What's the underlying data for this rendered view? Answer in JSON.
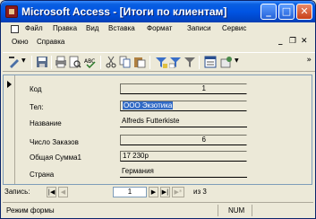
{
  "window": {
    "title": "Microsoft Access - [Итоги по клиентам]",
    "buttons": {
      "minimize": "_",
      "maximize": "□",
      "close": "✕"
    }
  },
  "menubar": {
    "items": [
      "Файл",
      "Правка",
      "Вид",
      "Вставка",
      "Формат",
      "Записи",
      "Сервис",
      "Окно",
      "Справка"
    ],
    "mdi": {
      "minimize": "_",
      "restore": "❐",
      "close": "✕"
    }
  },
  "toolbar": {
    "icons": [
      "design-view",
      "save",
      "print",
      "print-preview",
      "spelling",
      "cut",
      "copy",
      "paste",
      "filter-by-selection",
      "filter-by-form",
      "apply-filter",
      "properties",
      "new-object"
    ],
    "overflow": "»"
  },
  "form": {
    "fields": [
      {
        "label": "Код",
        "value": "1"
      },
      {
        "label": "Тел:",
        "value": "ООО Экзотика"
      },
      {
        "label": "Название",
        "value": "Alfreds Futterkiste"
      },
      {
        "label": "Число Заказов",
        "value": "6"
      },
      {
        "label": "Общая Сумма1",
        "value": "17 230р"
      },
      {
        "label": "Страна",
        "value": "Германия"
      }
    ]
  },
  "navigation": {
    "label": "Запись:",
    "current": "1",
    "total_label": "из 3",
    "buttons": {
      "first": "|◀",
      "prev": "◀",
      "next": "▶",
      "last": "▶|",
      "new": "▶*"
    }
  },
  "status": {
    "mode": "Режим формы",
    "num": "NUM"
  }
}
